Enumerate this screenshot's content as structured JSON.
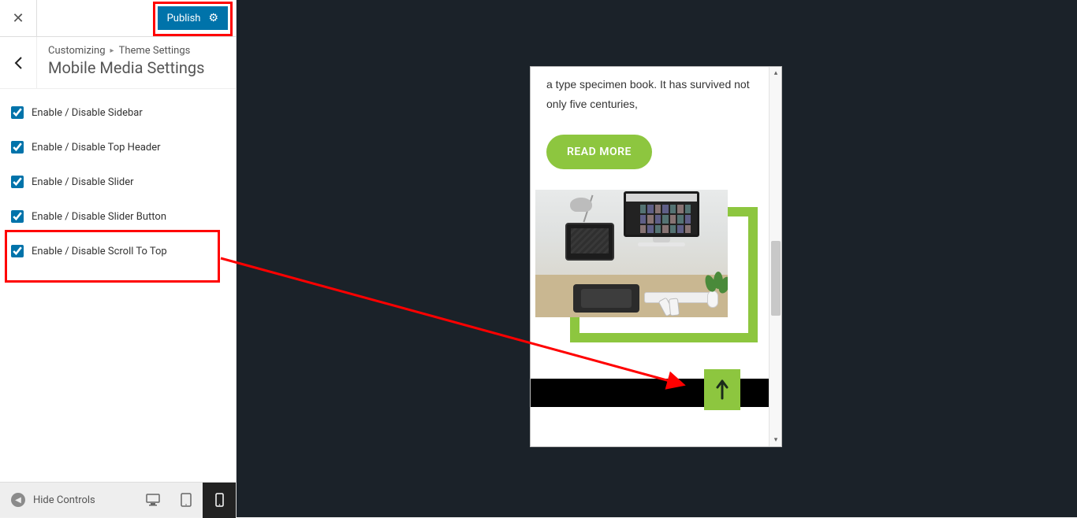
{
  "topbar": {
    "publish_label": "Publish"
  },
  "breadcrumb": {
    "root": "Customizing",
    "section": "Theme Settings",
    "title": "Mobile Media Settings"
  },
  "controls": [
    {
      "label": "Enable / Disable Sidebar",
      "checked": true
    },
    {
      "label": "Enable / Disable Top Header",
      "checked": true
    },
    {
      "label": "Enable / Disable Slider",
      "checked": true
    },
    {
      "label": "Enable / Disable Slider Button",
      "checked": true
    },
    {
      "label": "Enable / Disable Scroll To Top",
      "checked": true,
      "highlighted": true
    }
  ],
  "footer": {
    "hide_controls": "Hide Controls"
  },
  "preview": {
    "body_text": "a type specimen book. It has survived not only five centuries,",
    "read_more": "READ MORE"
  },
  "colors": {
    "accent": "#8dc63f",
    "wp_blue": "#0073aa",
    "annotation": "#ff0000"
  }
}
